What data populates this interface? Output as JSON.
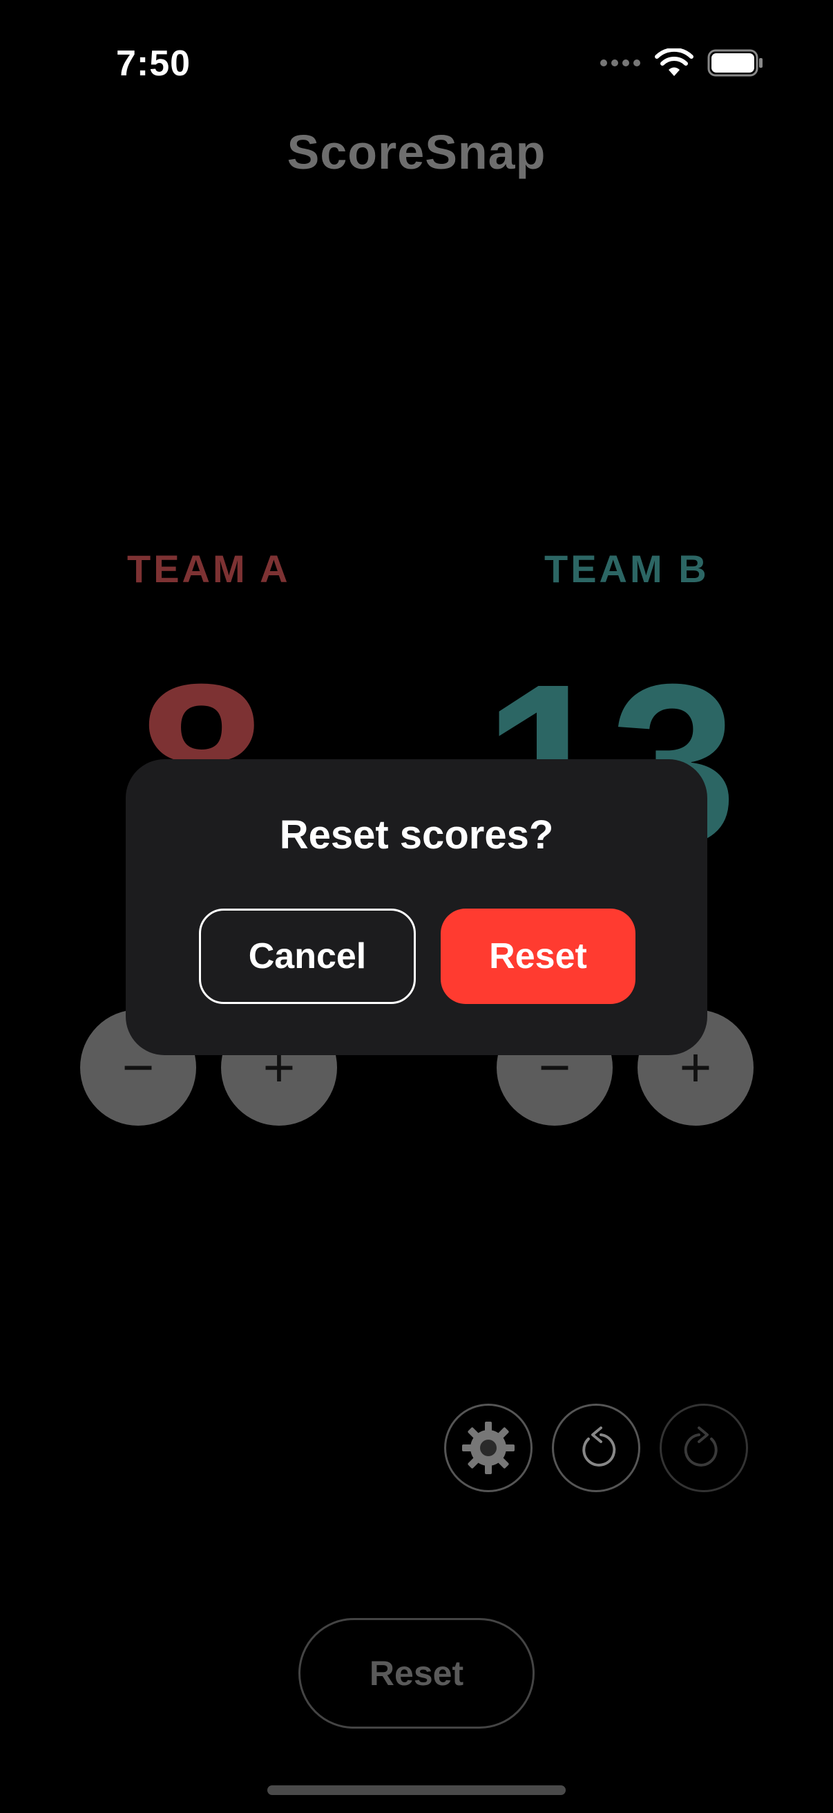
{
  "status_bar": {
    "time": "7:50"
  },
  "app": {
    "title": "ScoreSnap"
  },
  "teams": [
    {
      "label": "TEAM A",
      "score": "8",
      "color": "#7d3233"
    },
    {
      "label": "TEAM B",
      "score": "13",
      "color": "#2c6664"
    }
  ],
  "controls": {
    "minus_symbol": "−",
    "plus_symbol": "+"
  },
  "toolbar": {
    "icons": [
      "gear-icon",
      "undo-icon",
      "redo-icon"
    ]
  },
  "bottom": {
    "reset_label": "Reset"
  },
  "dialog": {
    "title": "Reset scores?",
    "cancel_label": "Cancel",
    "confirm_label": "Reset",
    "confirm_color": "#ff3b30"
  }
}
